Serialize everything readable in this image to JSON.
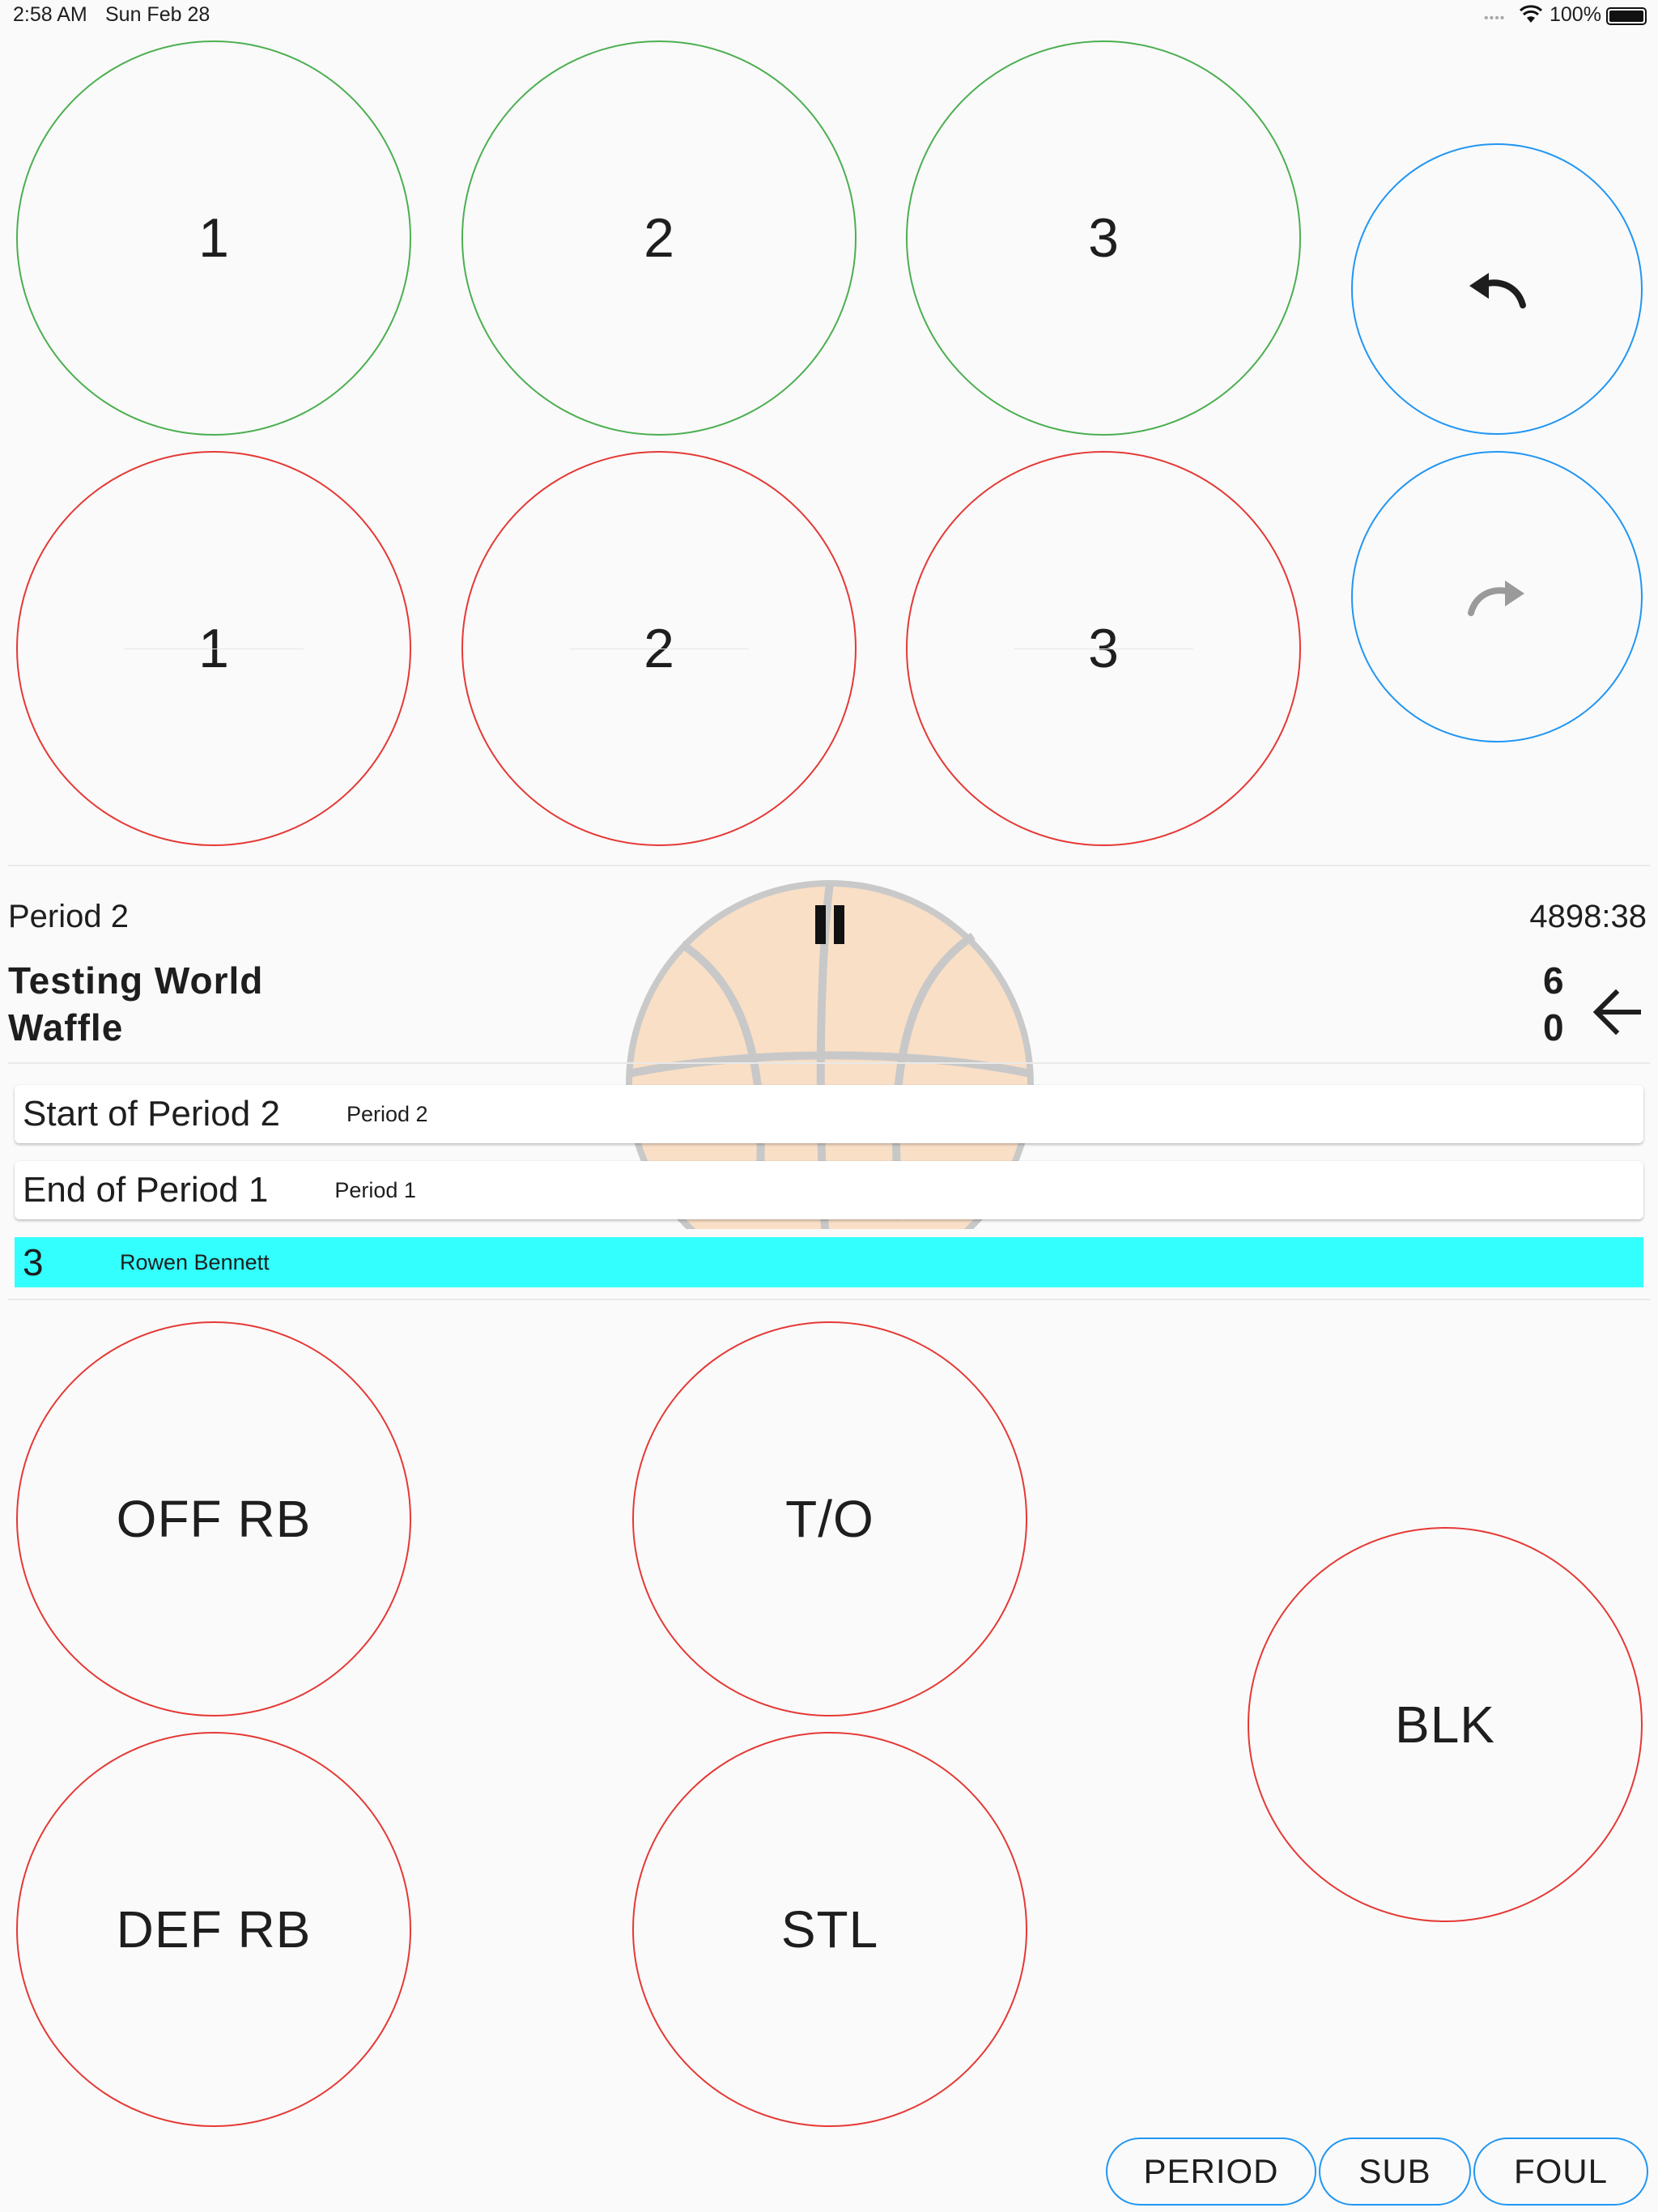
{
  "status_bar": {
    "time": "2:58 AM",
    "date": "Sun Feb 28",
    "battery": "100%",
    "wifi_icon": "wifi-icon",
    "battery_icon": "battery-icon"
  },
  "scoring": {
    "made": [
      "1",
      "2",
      "3"
    ],
    "missed": [
      "1",
      "2",
      "3"
    ],
    "made_color": "#4caf50",
    "missed_color": "#e53935"
  },
  "history_controls": {
    "undo_icon": "undo-icon",
    "redo_icon": "redo-icon",
    "color": "#2196f3"
  },
  "game": {
    "period": "Period 2",
    "clock": "4898:38",
    "team_home": "Testing World",
    "team_away": "Waffle",
    "score_home": "6",
    "score_away": "0",
    "pause_icon": "pause-icon",
    "arrow_icon": "arrow-left-icon"
  },
  "events": [
    {
      "title": "Start of Period 2",
      "subtitle": "Period 2"
    },
    {
      "title": "End of Period 1",
      "subtitle": "Period 1"
    }
  ],
  "selected_player": {
    "number": "3",
    "name": "Rowen Bennett",
    "highlight": "#33ffff"
  },
  "actions": {
    "off_rb": "OFF RB",
    "to": "T/O",
    "blk": "BLK",
    "def_rb": "DEF RB",
    "stl": "STL"
  },
  "bottom_buttons": {
    "period": "PERIOD",
    "sub": "SUB",
    "foul": "FOUL"
  }
}
